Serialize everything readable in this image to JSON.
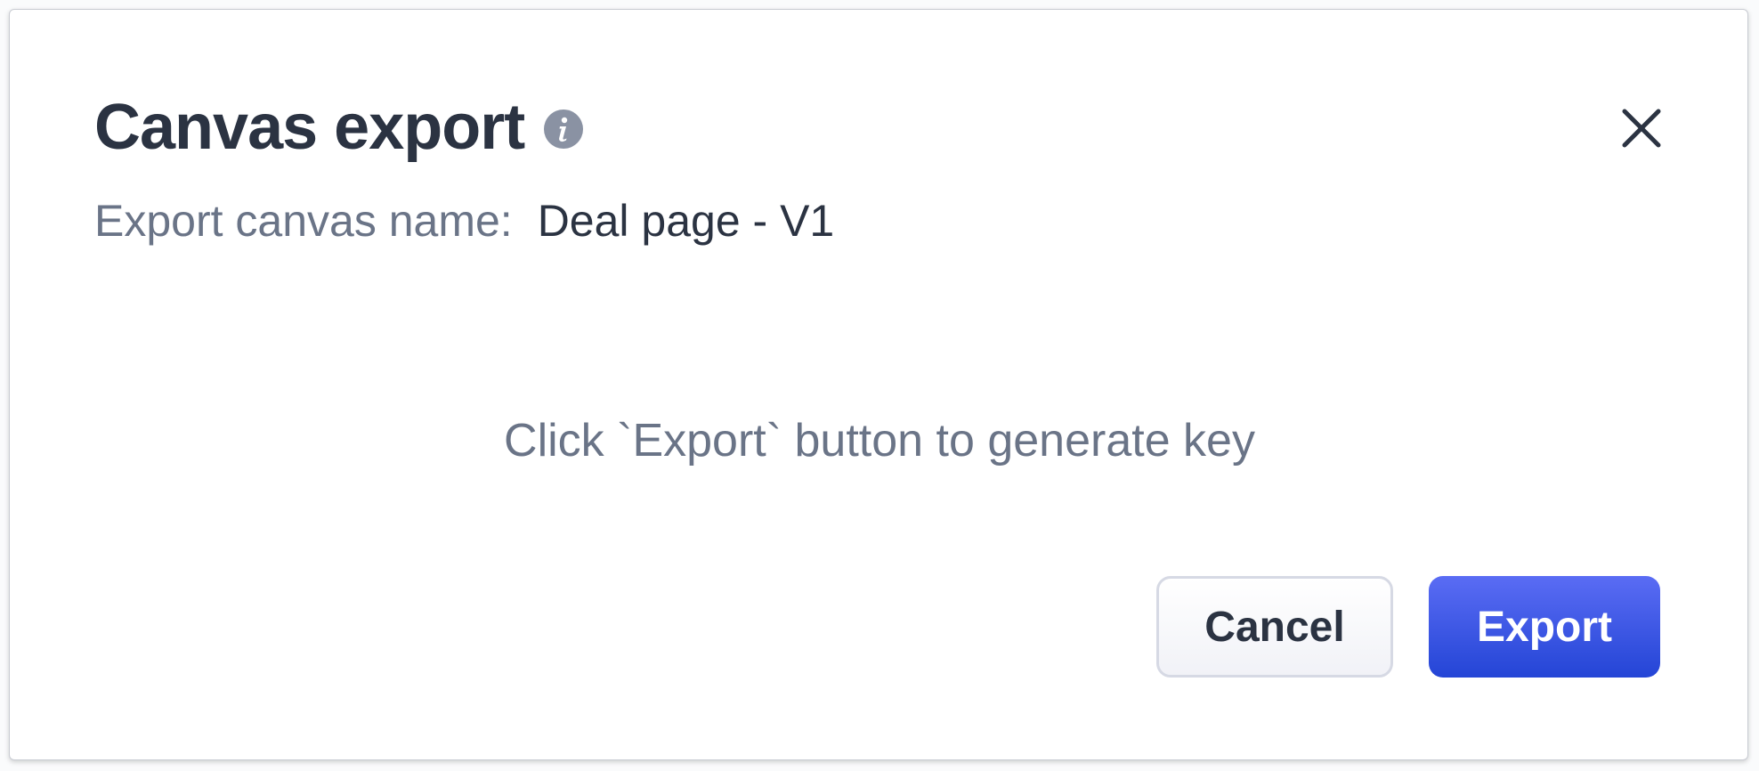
{
  "dialog": {
    "title": "Canvas export",
    "name_label": "Export canvas name:",
    "name_value": "Deal page - V1",
    "hint": "Click `Export` button to generate key",
    "cancel_label": "Cancel",
    "export_label": "Export",
    "info_icon": "info-icon",
    "close_icon": "close-icon",
    "colors": {
      "title": "#2b3342",
      "muted_text": "#6a7487",
      "primary": "#3452e6",
      "secondary_border": "#d6d9e4"
    }
  }
}
